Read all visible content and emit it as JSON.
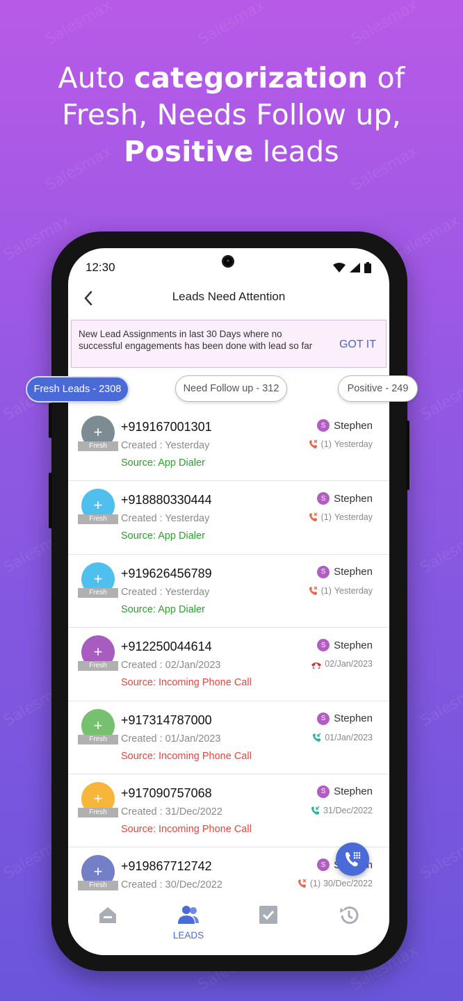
{
  "headline": {
    "line1_normal": "Auto ",
    "line1_bold": "categorization",
    "line1_tail": " of",
    "line2": "Fresh, Needs Follow up,",
    "line3_bold": "Positive",
    "line3_tail": " leads"
  },
  "watermark": "Salesmax",
  "status_bar": {
    "time": "12:30"
  },
  "app_bar": {
    "title": "Leads Need Attention"
  },
  "banner": {
    "text": "New Lead Assignments in last 30 Days where no successful engagements has been done with lead so far",
    "button": "GOT IT"
  },
  "tabs": [
    {
      "label": "Fresh Leads - 2308",
      "active": true
    },
    {
      "label": "Need Follow up - 312",
      "active": false
    },
    {
      "label": "Positive - 249",
      "active": false
    }
  ],
  "leads": [
    {
      "phone": "+919167001301",
      "created": "Created : Yesterday",
      "source": "Source: App Dialer",
      "source_color": "#2e9e2e",
      "avatar_color": "#7d8b92",
      "tag": "Fresh",
      "owner": "Stephen",
      "owner_initial": "S",
      "call_type": "missed",
      "call_count": "(1)",
      "call_date": "Yesterday"
    },
    {
      "phone": "+918880330444",
      "created": "Created : Yesterday",
      "source": "Source: App Dialer",
      "source_color": "#2e9e2e",
      "avatar_color": "#4fc0ee",
      "tag": "Fresh",
      "owner": "Stephen",
      "owner_initial": "S",
      "call_type": "missed",
      "call_count": "(1)",
      "call_date": "Yesterday"
    },
    {
      "phone": "+919626456789",
      "created": "Created : Yesterday",
      "source": "Source: App Dialer",
      "source_color": "#2e9e2e",
      "avatar_color": "#4fc0ee",
      "tag": "Fresh",
      "owner": "Stephen",
      "owner_initial": "S",
      "call_type": "missed",
      "call_count": "(1)",
      "call_date": "Yesterday"
    },
    {
      "phone": "+912250044614",
      "created": "Created : 02/Jan/2023",
      "source": "Source: Incoming Phone Call",
      "source_color": "#e8453c",
      "avatar_color": "#a85cbf",
      "tag": "Fresh",
      "owner": "Stephen",
      "owner_initial": "S",
      "call_type": "rejected",
      "call_count": "",
      "call_date": "02/Jan/2023"
    },
    {
      "phone": "+917314787000",
      "created": "Created : 01/Jan/2023",
      "source": "Source: Incoming Phone Call",
      "source_color": "#e8453c",
      "avatar_color": "#77c070",
      "tag": "Fresh",
      "owner": "Stephen",
      "owner_initial": "S",
      "call_type": "incoming",
      "call_count": "",
      "call_date": "01/Jan/2023"
    },
    {
      "phone": "+917090757068",
      "created": "Created : 31/Dec/2022",
      "source": "Source: Incoming Phone Call",
      "source_color": "#e8453c",
      "avatar_color": "#f7b53a",
      "tag": "Fresh",
      "owner": "Stephen",
      "owner_initial": "S",
      "call_type": "incoming",
      "call_count": "",
      "call_date": "31/Dec/2022"
    },
    {
      "phone": "+919867712742",
      "created": "Created : 30/Dec/2022",
      "source": "",
      "source_color": "#e8453c",
      "avatar_color": "#7380c8",
      "tag": "Fresh",
      "owner": "Stephen",
      "owner_initial": "S",
      "call_type": "missed",
      "call_count": "(1)",
      "call_date": "30/Dec/2022"
    }
  ],
  "bottom_nav": [
    {
      "name": "home",
      "label": ""
    },
    {
      "name": "leads",
      "label": "LEADS"
    },
    {
      "name": "tasks",
      "label": ""
    },
    {
      "name": "history",
      "label": ""
    }
  ],
  "colors": {
    "accent": "#4a6ad8",
    "missed": "#e8664c",
    "incoming": "#2bb3a0"
  }
}
